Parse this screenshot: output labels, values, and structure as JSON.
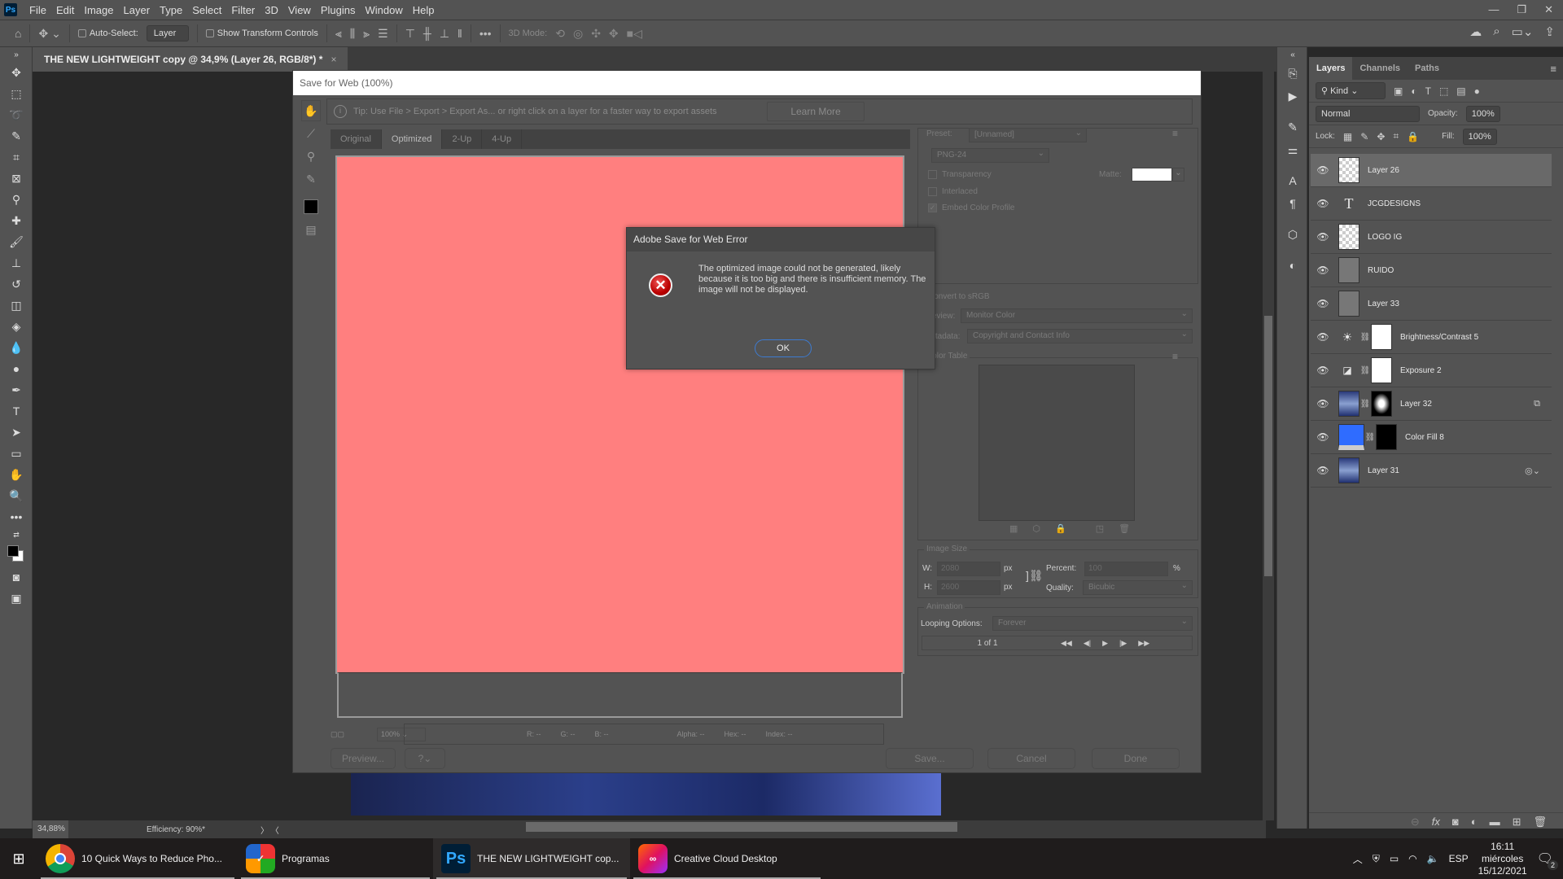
{
  "app": {
    "logo": "Ps"
  },
  "menu": [
    "File",
    "Edit",
    "Image",
    "Layer",
    "Type",
    "Select",
    "Filter",
    "3D",
    "View",
    "Plugins",
    "Window",
    "Help"
  ],
  "window_controls": {
    "minimize": "—",
    "restore": "❐",
    "close": "✕"
  },
  "options_bar": {
    "auto_select_label": "Auto-Select:",
    "auto_select_checked": false,
    "target_value": "Layer",
    "show_transform_label": "Show Transform Controls",
    "show_transform_checked": false,
    "mode_label": "3D Mode:"
  },
  "document_tab": {
    "title": "THE NEW LIGHTWEIGHT copy @ 34,9% (Layer 26, RGB/8*) *",
    "close": "×"
  },
  "status": {
    "zoom": "34,88%",
    "efficiency": "Efficiency: 90%*"
  },
  "layers_panel": {
    "tabs": [
      "Layers",
      "Channels",
      "Paths"
    ],
    "active_tab": "Layers",
    "filter_kind": "Kind",
    "blend_mode": "Normal",
    "opacity_label": "Opacity:",
    "opacity": "100%",
    "lock_label": "Lock:",
    "fill_label": "Fill:",
    "fill": "100%",
    "layers": [
      {
        "name": "Layer 26",
        "type": "smart-object",
        "selected": true,
        "visible": true
      },
      {
        "name": "JCGDESIGNS",
        "type": "text",
        "selected": false,
        "visible": true
      },
      {
        "name": "LOGO IG",
        "type": "transparent",
        "selected": false,
        "visible": true
      },
      {
        "name": "RUIDO",
        "type": "gray",
        "selected": false,
        "visible": true
      },
      {
        "name": "Layer 33",
        "type": "gray",
        "selected": false,
        "visible": true
      },
      {
        "name": "Brightness/Contrast 5",
        "type": "adjustment-brightness",
        "selected": false,
        "visible": true
      },
      {
        "name": "Exposure 2",
        "type": "adjustment-exposure",
        "selected": false,
        "visible": true
      },
      {
        "name": "Layer 32",
        "type": "image-with-mask",
        "selected": false,
        "visible": true,
        "badge": "clip-icon"
      },
      {
        "name": "Color Fill 8",
        "type": "color-fill",
        "fill_color": "#2f6cff",
        "selected": false,
        "visible": true
      },
      {
        "name": "Layer 31",
        "type": "smart-object-image",
        "selected": false,
        "visible": true,
        "badge": "effects-icon"
      }
    ]
  },
  "save_for_web": {
    "title": "Save for Web (100%)",
    "tip": "Tip: Use File > Export > Export As...  or right click on a layer for a faster way to export assets",
    "learn_more": "Learn More",
    "view_tabs": [
      "Original",
      "Optimized",
      "2-Up",
      "4-Up"
    ],
    "active_view_tab": "Optimized",
    "preview_color": "#ff7f7f",
    "preset_label": "Preset:",
    "preset_value": "[Unnamed]",
    "format_value": "PNG-24",
    "transparency_label": "Transparency",
    "transparency_checked": false,
    "interlaced_label": "Interlaced",
    "interlaced_checked": false,
    "embed_label": "Embed Color Profile",
    "embed_checked": true,
    "matte_label": "Matte:",
    "convert_label": "Convert to sRGB",
    "preview_label": "Preview:",
    "preview_value": "Monitor Color",
    "metadata_label": "Metadata:",
    "metadata_value": "Copyright and Contact Info",
    "color_table_label": "Color Table",
    "image_size_label": "Image Size",
    "w_label": "W:",
    "w_value": "2080",
    "h_label": "H:",
    "h_value": "2600",
    "px": "px",
    "percent_label": "Percent:",
    "percent_value": "100",
    "percent_sign": "%",
    "quality_label": "Quality:",
    "quality_value": "Bicubic",
    "animation_label": "Animation",
    "looping_label": "Looping Options:",
    "looping_value": "Forever",
    "frame_counter": "1 of 1",
    "zoom_value": "100%",
    "readout": {
      "r": "R: --",
      "g": "G: --",
      "b": "B: --",
      "alpha": "Alpha: --",
      "hex": "Hex: --",
      "index": "Index: --"
    },
    "buttons": {
      "preview": "Preview...",
      "save": "Save...",
      "cancel": "Cancel",
      "done": "Done"
    }
  },
  "error_dialog": {
    "title": "Adobe Save for Web Error",
    "message": "The optimized image could not be generated, likely because it is too big and there is insufficient memory. The image will not be displayed.",
    "ok": "OK"
  },
  "taskbar": {
    "items": [
      {
        "label": "10 Quick Ways to Reduce Pho...",
        "app": "chrome"
      },
      {
        "label": "Programas",
        "app": "programas"
      },
      {
        "label": "THE NEW LIGHTWEIGHT cop...",
        "app": "photoshop",
        "active": true
      },
      {
        "label": "Creative Cloud Desktop",
        "app": "creative-cloud"
      }
    ],
    "language": "ESP",
    "time": "16:11",
    "day": "miércoles",
    "date": "15/12/2021",
    "notifications": "2"
  }
}
